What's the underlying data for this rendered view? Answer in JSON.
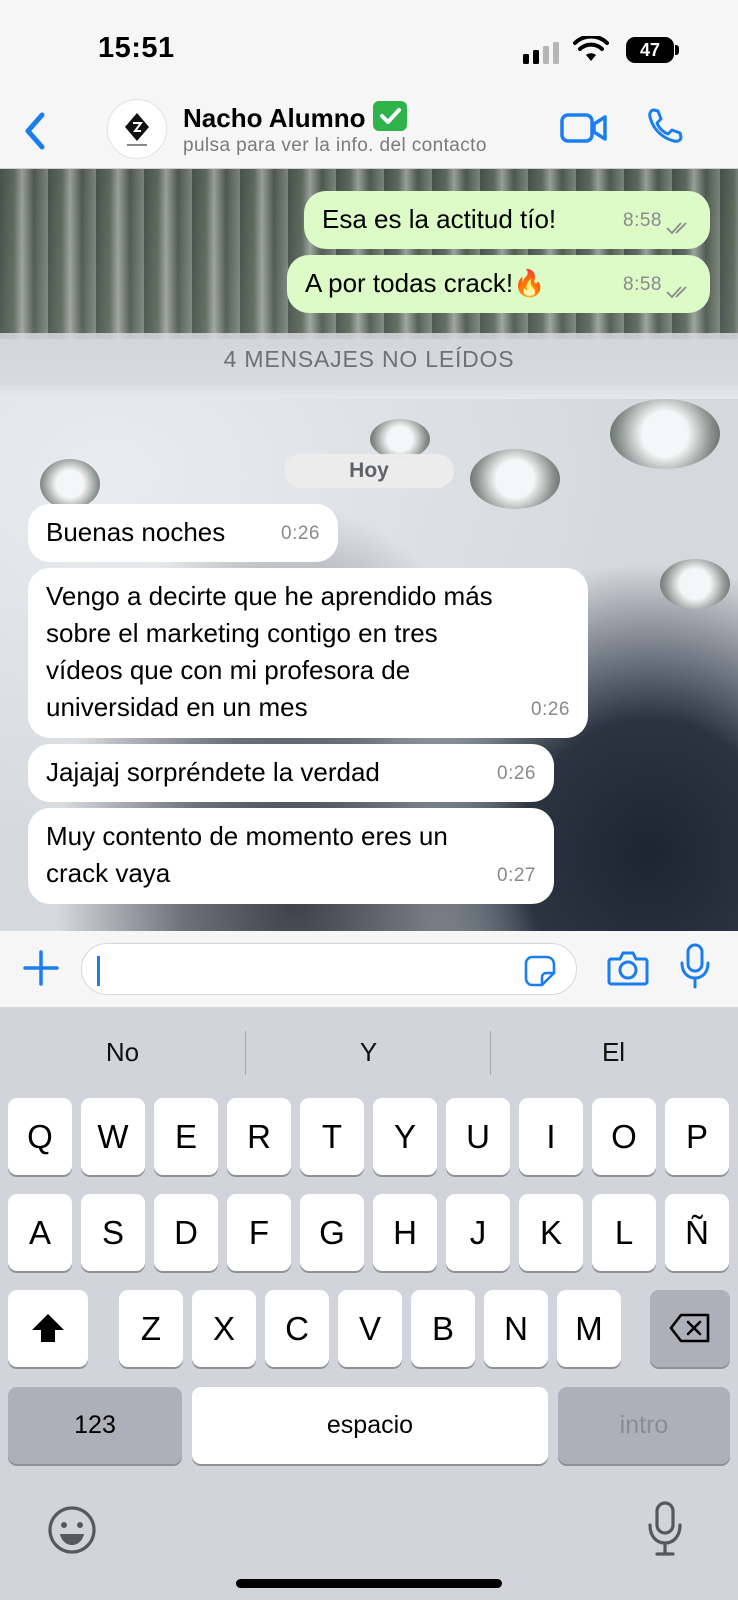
{
  "status_bar": {
    "time": "15:51",
    "battery": "47"
  },
  "header": {
    "back_icon": "chevron-left-icon",
    "contact_name": "Nacho Alumno",
    "verified_icon": "check-mark-button-icon",
    "subtitle": "pulsa para ver la info. del contacto",
    "video_icon": "video-camera-icon",
    "call_icon": "phone-icon",
    "accent": "#1a7ef0"
  },
  "chat": {
    "outgoing": [
      {
        "text": "Esa es la actitud tío!",
        "time": "8:58"
      },
      {
        "text": "A por todas crack!🔥",
        "time": "8:58"
      }
    ],
    "unread_banner": "4 MENSAJES NO LEÍDOS",
    "day_label": "Hoy",
    "incoming": [
      {
        "text": "Buenas noches",
        "time": "0:26"
      },
      {
        "lines": [
          "Vengo a decirte que he aprendido más",
          "sobre el marketing contigo en tres",
          "vídeos que con mi profesora de",
          "universidad en un mes"
        ],
        "time": "0:26"
      },
      {
        "text": "Jajajaj sorpréndete la verdad",
        "time": "0:26"
      },
      {
        "lines": [
          "Muy contento de momento eres un",
          "crack vaya"
        ],
        "time": "0:27"
      }
    ],
    "outgoing_bubble_color": "#dcfbc6",
    "incoming_bubble_color": "#ffffff"
  },
  "input_bar": {
    "value": "",
    "icons": [
      "plus-icon",
      "sticker-icon",
      "camera-icon",
      "microphone-icon"
    ]
  },
  "keyboard": {
    "suggestions": [
      "No",
      "Y",
      "El"
    ],
    "row1": [
      "Q",
      "W",
      "E",
      "R",
      "T",
      "Y",
      "U",
      "I",
      "O",
      "P"
    ],
    "row2": [
      "A",
      "S",
      "D",
      "F",
      "G",
      "H",
      "J",
      "K",
      "L",
      "Ñ"
    ],
    "row3": [
      "Z",
      "X",
      "C",
      "V",
      "B",
      "N",
      "M"
    ],
    "numbers_label": "123",
    "space_label": "espacio",
    "return_label": "intro"
  }
}
